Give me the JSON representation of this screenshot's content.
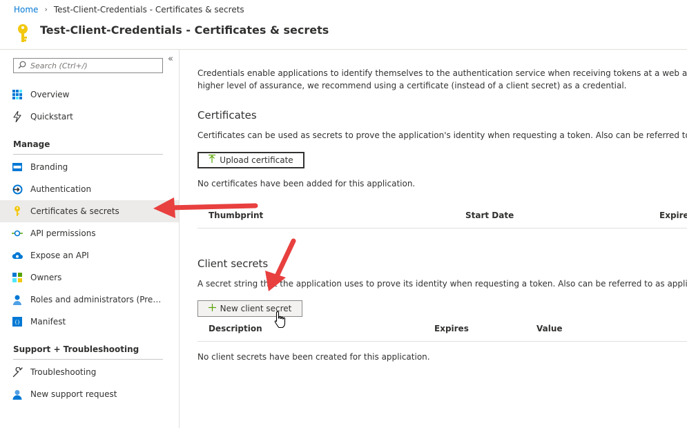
{
  "breadcrumb": {
    "home": "Home",
    "current": "Test-Client-Credentials - Certificates & secrets"
  },
  "header": {
    "title": "Test-Client-Credentials - Certificates & secrets",
    "icon": "key-icon"
  },
  "sidebar": {
    "collapse_label": "«",
    "search_placeholder": "Search (Ctrl+/)",
    "items_top": [
      {
        "label": "Overview",
        "icon": "overview-grid-icon"
      },
      {
        "label": "Quickstart",
        "icon": "lightning-icon"
      }
    ],
    "manage_heading": "Manage",
    "manage_items": [
      {
        "label": "Branding",
        "icon": "branding-icon"
      },
      {
        "label": "Authentication",
        "icon": "authentication-icon"
      },
      {
        "label": "Certificates & secrets",
        "icon": "key-icon",
        "active": true
      },
      {
        "label": "API permissions",
        "icon": "api-permissions-icon"
      },
      {
        "label": "Expose an API",
        "icon": "cloud-icon"
      },
      {
        "label": "Owners",
        "icon": "owners-icon"
      },
      {
        "label": "Roles and administrators (Previ...",
        "icon": "roles-user-icon"
      },
      {
        "label": "Manifest",
        "icon": "manifest-icon"
      }
    ],
    "support_heading": "Support + Troubleshooting",
    "support_items": [
      {
        "label": "Troubleshooting",
        "icon": "wrench-icon"
      },
      {
        "label": "New support request",
        "icon": "support-person-icon"
      }
    ]
  },
  "main": {
    "intro_line1": "Credentials enable applications to identify themselves to the authentication service when receiving tokens at a web addressab",
    "intro_line2": "higher level of assurance, we recommend using a certificate (instead of a client secret) as a credential.",
    "certificates": {
      "title": "Certificates",
      "description": "Certificates can be used as secrets to prove the application's identity when requesting a token. Also can be referred to as pub",
      "upload_button": "Upload certificate",
      "empty_text": "No certificates have been added for this application.",
      "columns": [
        "Thumbprint",
        "Start Date",
        "Expires"
      ]
    },
    "client_secrets": {
      "title": "Client secrets",
      "description": "A secret string that the application uses to prove its identity when requesting a token. Also can be referred to as application p",
      "new_button": "New client secret",
      "columns": [
        "Description",
        "Expires",
        "Value"
      ],
      "empty_text": "No client secrets have been created for this application."
    }
  },
  "colors": {
    "accent": "#0078d4",
    "annotation_arrow": "#e8403f",
    "active_nav": "#edebe9",
    "plus_green": "#57a300"
  }
}
